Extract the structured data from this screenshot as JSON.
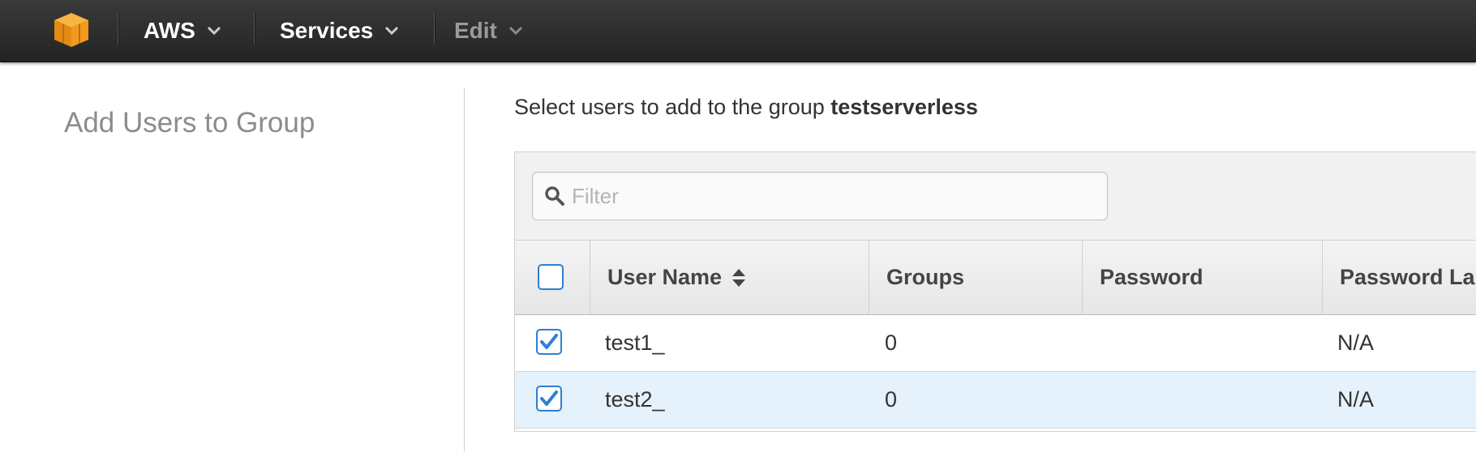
{
  "nav": {
    "logo_icon": "aws-cube-icon",
    "menus": [
      {
        "label": "AWS",
        "enabled": true
      },
      {
        "label": "Services",
        "enabled": true
      },
      {
        "label": "Edit",
        "enabled": false
      }
    ]
  },
  "sidebar": {
    "title": "Add Users to Group"
  },
  "main": {
    "instruction_prefix": "Select users to add to the group ",
    "group_name": "testserverless",
    "filter": {
      "placeholder": "Filter",
      "value": ""
    },
    "table": {
      "columns": [
        "User Name",
        "Groups",
        "Password",
        "Password La"
      ],
      "select_all_checked": false,
      "rows": [
        {
          "checked": true,
          "user_name": "test1_",
          "groups": "0",
          "password": "",
          "password_last_used": "N/A",
          "selected": false
        },
        {
          "checked": true,
          "user_name": "test2_",
          "groups": "0",
          "password": "",
          "password_last_used": "N/A",
          "selected": true
        }
      ]
    }
  },
  "colors": {
    "accent": "#2f7fd0",
    "logo": "#f29a1e",
    "topbar": "#2b2b2b",
    "row_selected": "#e5f1fb"
  }
}
